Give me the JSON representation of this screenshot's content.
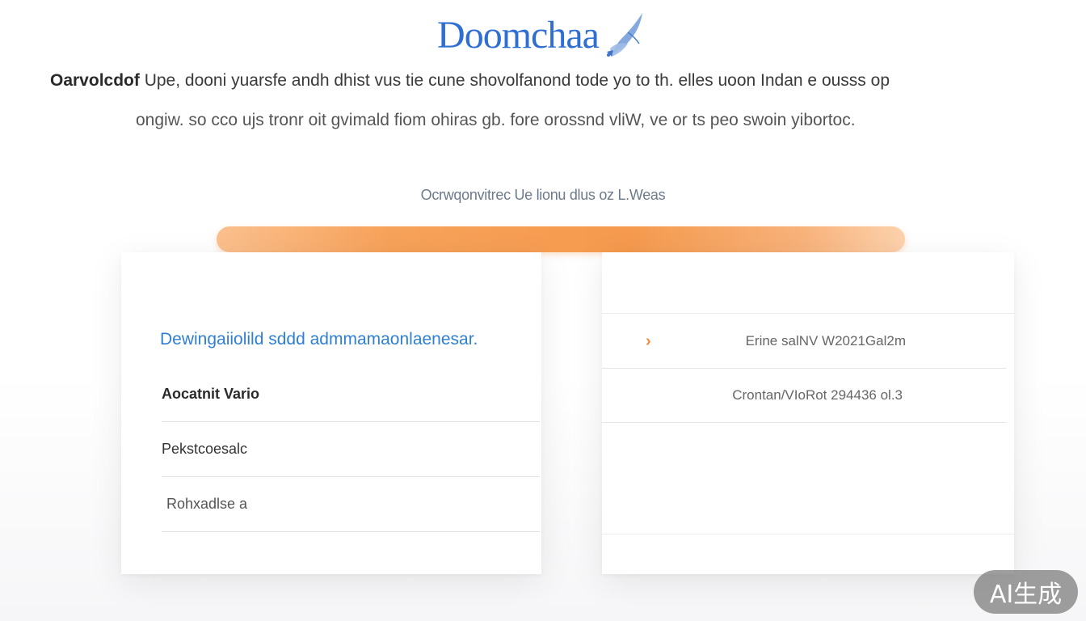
{
  "header": {
    "logo_text": "Doomchaa",
    "logo_icon": "feather-brush-icon",
    "logo_color": "#2f6fd1"
  },
  "description": {
    "line1_lead": "Oarvolcdof",
    "line1_rest": " Upe, dooni yuarsfe andh dhist vus tie cune shovolfanond tode yo to th. elles uoon Indan e ousss op",
    "line2": "ongiw. so cco ujs tronr oit gvimald fiom ohiras gb. fore orossnd vliW, ve or ts peo swoin yibortoc."
  },
  "progress": {
    "label": "Ocrwqonvitrec Ue lionu dlus oz L.Weas",
    "value": 1.0,
    "accent_color": "#f59a4e"
  },
  "left_card": {
    "heading": "Dewingaiiolild sddd admmamaonlaenesar.",
    "rows": [
      {
        "label": "Aocatnit Vario"
      },
      {
        "label": "Pekstcoesalc"
      },
      {
        "label": "Rohxadlse a"
      }
    ]
  },
  "right_card": {
    "rows": [
      {
        "icon": "chevron-right-icon",
        "value": "Erine salNV W2021Gal2m"
      },
      {
        "icon": "",
        "value": "Crontan/VIoRot 294436 ol.3"
      }
    ]
  },
  "badge": {
    "label": "AI生成"
  }
}
